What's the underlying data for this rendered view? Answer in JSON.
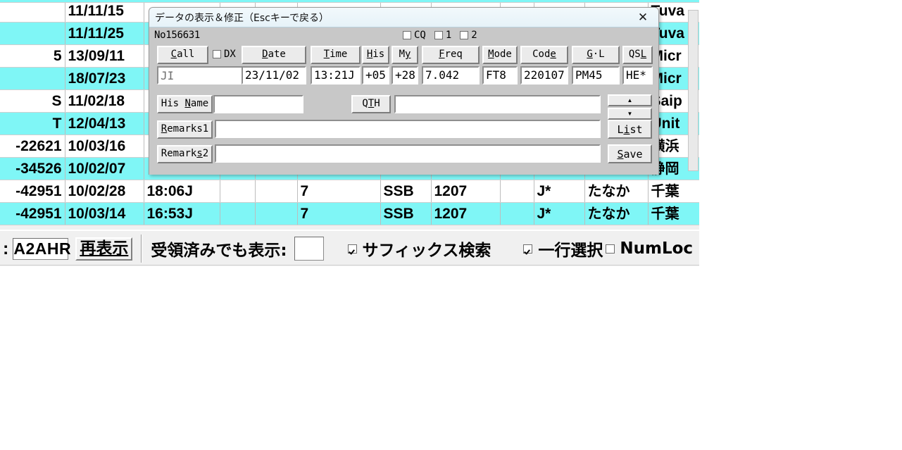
{
  "log_window": {
    "columns": [
      "qsl_no",
      "date",
      "time",
      "blank1",
      "band",
      "mode",
      "code",
      "blank2",
      "prefix",
      "name",
      "qth"
    ],
    "rows": [
      {
        "a": "",
        "b": "11/11/15",
        "c": "",
        "d": "",
        "e": "",
        "f": "",
        "g": "",
        "h": "",
        "i": "",
        "j": "",
        "k": "",
        "l": "Tuva",
        "highlight": false
      },
      {
        "a": "",
        "b": "11/11/25",
        "c": "",
        "d": "",
        "e": "",
        "f": "",
        "g": "",
        "h": "",
        "i": "",
        "j": "",
        "k": "",
        "l": "Tuva",
        "highlight": true
      },
      {
        "a": "5",
        "b": "13/09/11",
        "c": "",
        "d": "",
        "e": "",
        "f": "",
        "g": "",
        "h": "",
        "i": "",
        "j": "",
        "k": "",
        "l": "Micr",
        "highlight": false
      },
      {
        "a": "",
        "b": "18/07/23",
        "c": "",
        "d": "",
        "e": "",
        "f": "",
        "g": "",
        "h": "",
        "i": "",
        "j": "",
        "k": "",
        "l": "Micr",
        "highlight": true
      },
      {
        "a": "S",
        "b": "11/02/18",
        "c": "",
        "d": "",
        "e": "",
        "f": "",
        "g": "",
        "h": "",
        "i": "",
        "j": "",
        "k": "",
        "l": "Saip",
        "highlight": false
      },
      {
        "a": "T",
        "b": "12/04/13",
        "c": "",
        "d": "",
        "e": "",
        "f": "",
        "g": "",
        "h": "",
        "i": "",
        "j": "",
        "k": "",
        "l": "Unit",
        "highlight": true
      },
      {
        "a": "-22621",
        "b": "10/03/16",
        "c": "",
        "d": "",
        "e": "",
        "f": "",
        "g": "",
        "h": "",
        "i": "",
        "j": "",
        "k": "",
        "l": "横浜",
        "highlight": false
      },
      {
        "a": "-34526",
        "b": "10/02/07",
        "c": "",
        "d": "",
        "e": "",
        "f": "",
        "g": "",
        "h": "",
        "i": "",
        "j": "",
        "k": "",
        "l": "静岡",
        "highlight": true
      },
      {
        "a": "-42951",
        "b": "10/02/28",
        "c": "18:06J",
        "d": "",
        "e": "",
        "f": "7",
        "g": "SSB",
        "h": "1207",
        "i": "",
        "j": "J*",
        "k": "たなか",
        "l": "千葉",
        "highlight": false
      },
      {
        "a": "-42951",
        "b": "10/03/14",
        "c": "16:53J",
        "d": "",
        "e": "",
        "f": "7",
        "g": "SSB",
        "h": "1207",
        "i": "",
        "j": "J*",
        "k": "たなか",
        "l": "千葉",
        "highlight": true
      }
    ]
  },
  "bottom_bar": {
    "colon_label": ":",
    "call_search_value": "A2AHR",
    "refresh_button": "再表示",
    "show_received_label": "受領済みでも表示:",
    "show_received_value": "",
    "suffix_search_label": "サフィックス検索",
    "suffix_search_checked": true,
    "single_row_label": "一行選択",
    "single_row_checked": true,
    "numlock_label": "NumLoc",
    "numlock_checked": false
  },
  "dialog": {
    "title": "データの表示＆修正（Escキーで戻る）",
    "close_icon": "close-icon",
    "record_no": "No156631",
    "flags": [
      {
        "label": "CQ",
        "checked": false
      },
      {
        "label": "1",
        "checked": false
      },
      {
        "label": "2",
        "checked": false
      }
    ],
    "fields": {
      "call": {
        "button": "Call",
        "accel": "C",
        "value": "JI",
        "redacted": true
      },
      "dx": {
        "label": "DX",
        "checked": false
      },
      "date": {
        "button": "Date",
        "accel": "D",
        "value": "23/11/02"
      },
      "time": {
        "button": "Time",
        "accel": "T",
        "value": "13:21J"
      },
      "his": {
        "button": "His",
        "accel": "H",
        "value": "+05"
      },
      "my": {
        "button": "My",
        "accel": "y",
        "value": "+28"
      },
      "freq": {
        "button": "Freq",
        "accel": "F",
        "value": "7.042"
      },
      "mode": {
        "button": "Mode",
        "accel": "M",
        "value": "FT8"
      },
      "code": {
        "button": "Code",
        "accel": "e",
        "value": "220107"
      },
      "gl": {
        "button": "G·L",
        "accel": "G",
        "value": "PM45"
      },
      "qsl": {
        "button": "QSL",
        "accel": "L",
        "value": "HE*"
      },
      "his_name": {
        "button": "His Name",
        "accel": "N",
        "value": "",
        "redacted": true
      },
      "qth": {
        "button": "QTH",
        "accel": "T",
        "value": "",
        "redacted": true
      },
      "remarks1": {
        "button": "Remarks1",
        "accel": "R",
        "value": ""
      },
      "remarks2": {
        "button": "Remarks2",
        "accel": "s",
        "value": ""
      }
    },
    "spinner": {
      "up": "▲",
      "down": "▼"
    },
    "list_button": "List",
    "list_accel": "i",
    "save_button": "Save",
    "save_accel": "S"
  },
  "colors": {
    "highlight_row": "#7ff6f6",
    "dialog_face": "#c8c8c8",
    "titlebar": "#eaf4fa",
    "button_face": "#ebebeb",
    "window_face": "#f0f0f0"
  }
}
